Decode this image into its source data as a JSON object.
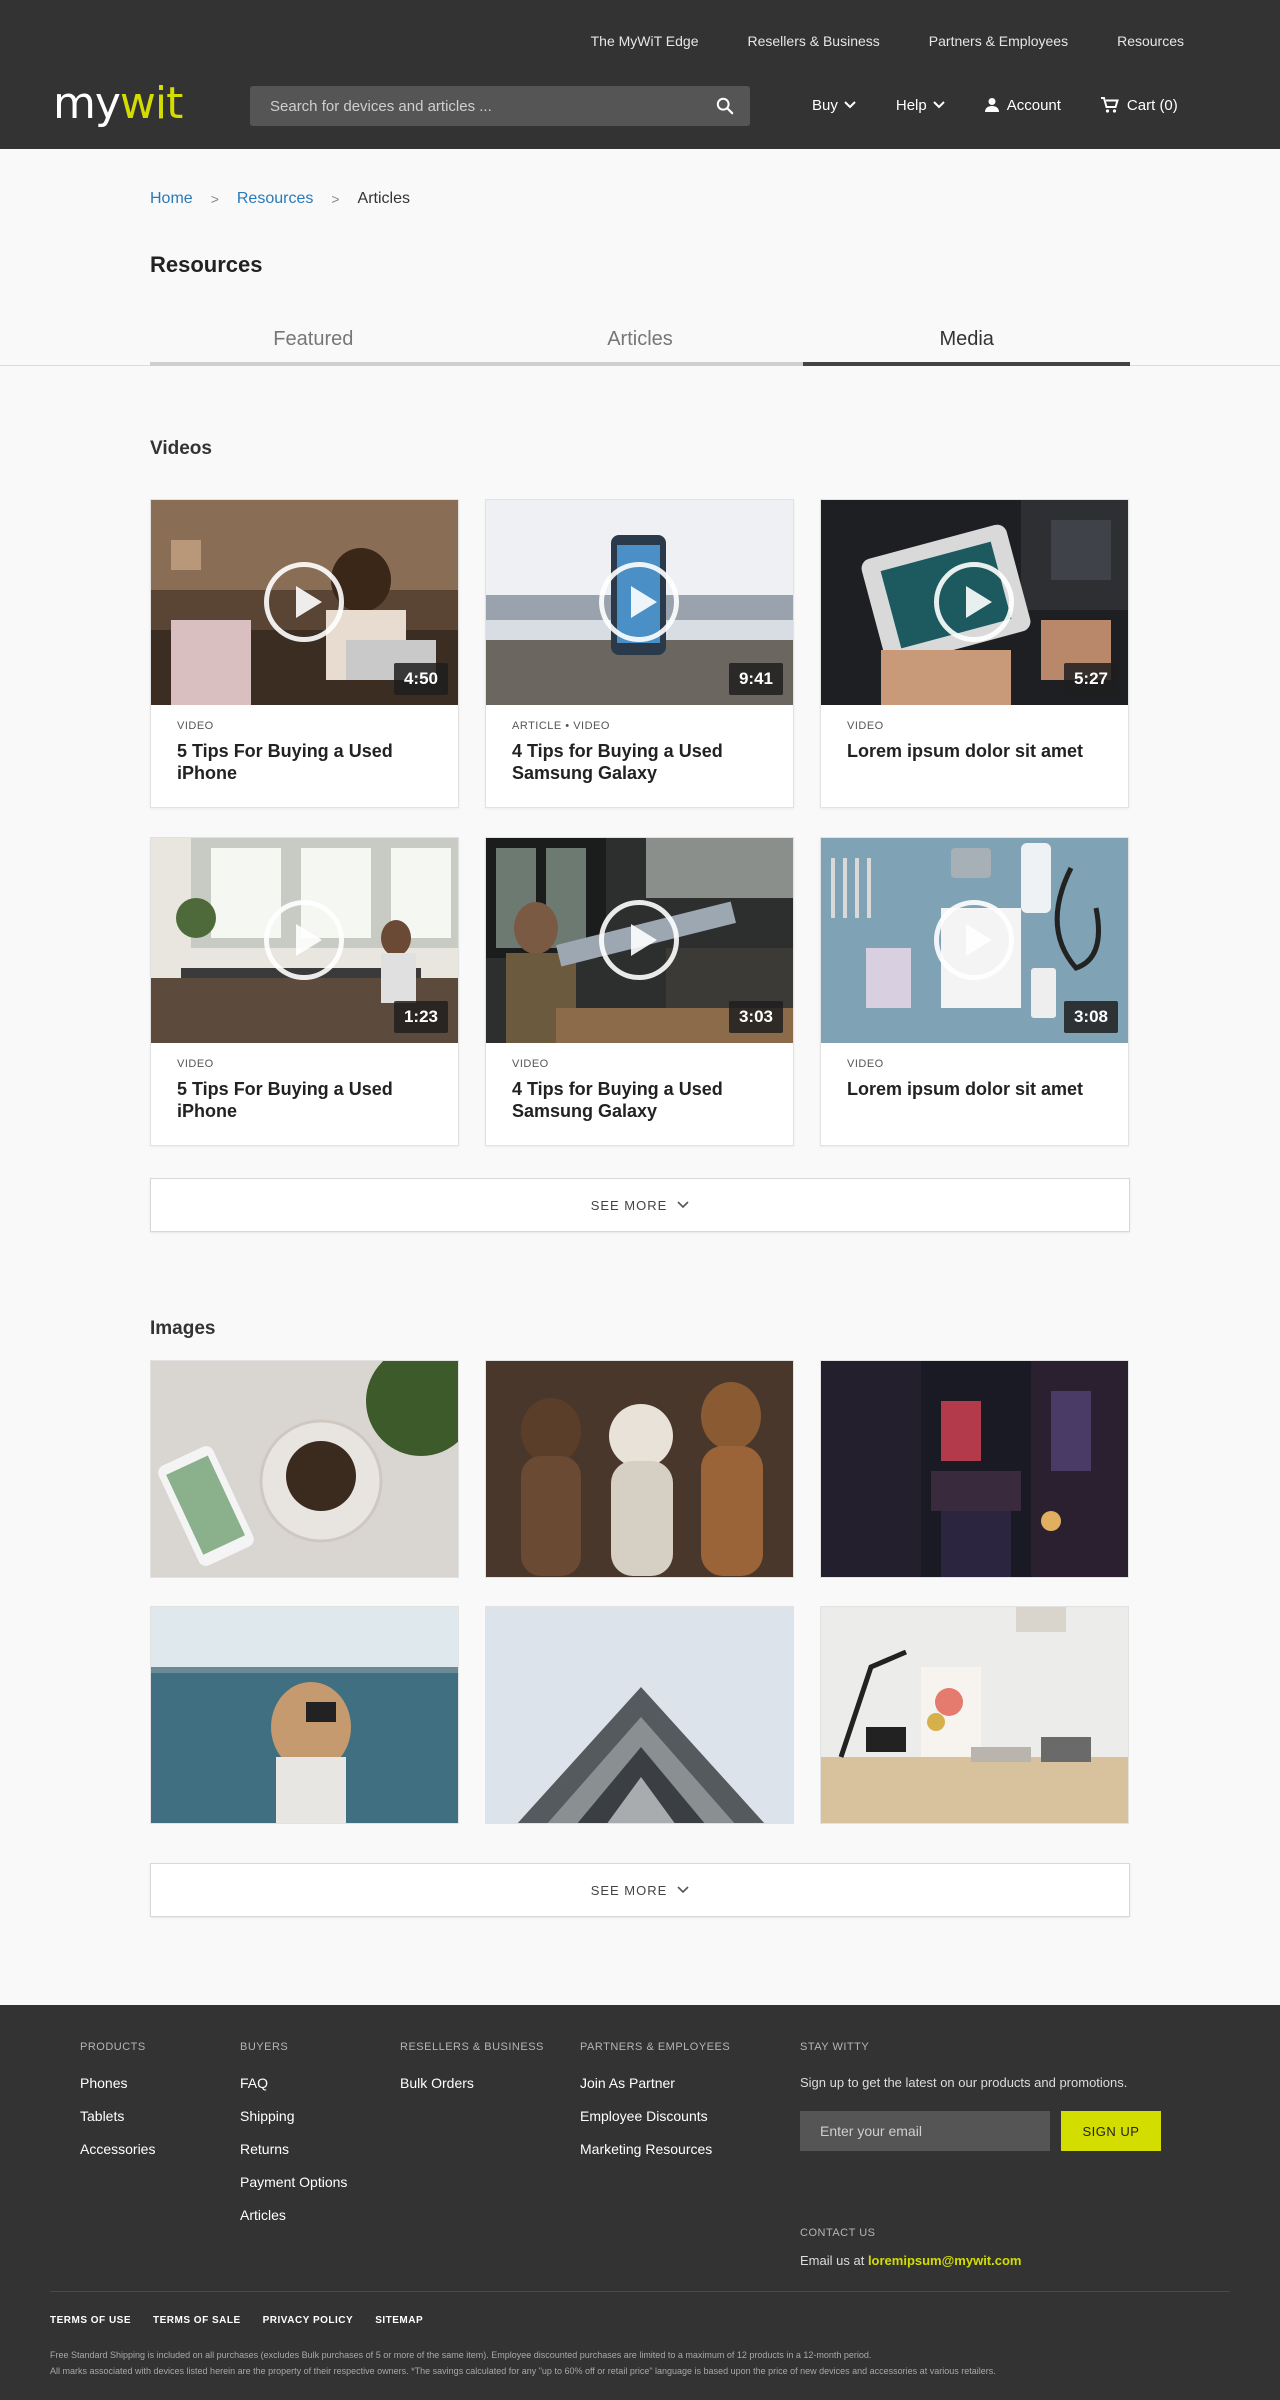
{
  "header": {
    "top_links": [
      "The MyWiT Edge",
      "Resellers & Business",
      "Partners & Employees",
      "Resources"
    ],
    "logo_prefix": "my",
    "logo_suffix": "wit",
    "search_placeholder": "Search for devices and articles ...",
    "nav": {
      "buy": "Buy",
      "help": "Help",
      "account": "Account",
      "cart_label": "Cart",
      "cart_count": "(0)"
    }
  },
  "breadcrumb": {
    "home": "Home",
    "resources": "Resources",
    "current": "Articles",
    "separator": ">"
  },
  "page_title": "Resources",
  "tabs": [
    "Featured",
    "Articles",
    "Media"
  ],
  "active_tab": "Media",
  "videos": {
    "title": "Videos",
    "items": [
      {
        "meta": "VIDEO",
        "title": "5 Tips For Buying a Used iPhone",
        "duration": "4:50"
      },
      {
        "meta": "ARTICLE • VIDEO",
        "title": "4 Tips for Buying a Used Samsung Galaxy",
        "duration": "9:41"
      },
      {
        "meta": "VIDEO",
        "title": "Lorem ipsum dolor sit amet",
        "duration": "5:27"
      },
      {
        "meta": "VIDEO",
        "title": "5 Tips For Buying a Used iPhone",
        "duration": "1:23"
      },
      {
        "meta": "VIDEO",
        "title": "4 Tips for Buying a Used Samsung Galaxy",
        "duration": "3:03"
      },
      {
        "meta": "VIDEO",
        "title": "Lorem ipsum dolor sit amet",
        "duration": "3:08"
      }
    ],
    "see_more": "SEE MORE"
  },
  "images": {
    "title": "Images",
    "see_more": "SEE MORE"
  },
  "footer": {
    "products": {
      "head": "PRODUCTS",
      "links": [
        "Phones",
        "Tablets",
        "Accessories"
      ]
    },
    "buyers": {
      "head": "BUYERS",
      "links": [
        "FAQ",
        "Shipping",
        "Returns",
        "Payment Options",
        "Articles"
      ]
    },
    "resellers": {
      "head": "RESELLERS & BUSINESS",
      "links": [
        "Bulk Orders"
      ]
    },
    "partners": {
      "head": "PARTNERS & EMPLOYEES",
      "links": [
        "Join As Partner",
        "Employee Discounts",
        "Marketing Resources"
      ]
    },
    "stay": {
      "head": "STAY WITTY",
      "text": "Sign up to get the latest on our products and promotions.",
      "email_placeholder": "Enter your email",
      "button": "SIGN UP"
    },
    "contact": {
      "head": "CONTACT US",
      "prefix": "Email us at",
      "email": "loremipsum@mywit.com"
    },
    "legal_links": [
      "TERMS OF USE",
      "TERMS OF SALE",
      "PRIVACY POLICY",
      "SITEMAP"
    ],
    "fine_print_1": "Free Standard Shipping is included on all purchases (excludes Bulk purchases of 5 or more of the same item). Employee discounted purchases are limited to a maximum of 12 products in a 12-month period.",
    "fine_print_2": "All marks associated with devices listed herein are the property of their respective owners. *The savings calculated for any \"up to 60% off or retail price\" language is based upon the price of new devices and accessories at various retailers."
  },
  "colors": {
    "header_bg": "#333333",
    "accent": "#d4dd00",
    "link": "#2a7ab8"
  }
}
